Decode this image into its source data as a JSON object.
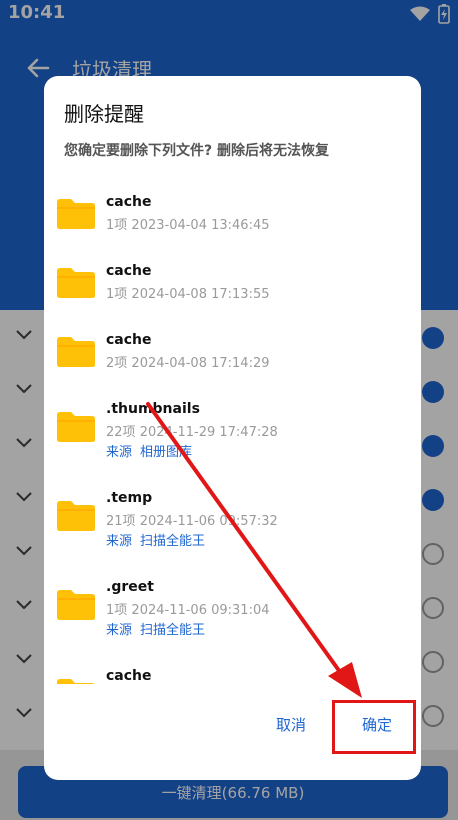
{
  "status": {
    "time": "10:41"
  },
  "app": {
    "title": "垃圾清理",
    "clean_button": "一键清理(66.76 MB)"
  },
  "dialog": {
    "title": "删除提醒",
    "message": "您确定要删除下列文件? 删除后将无法恢复",
    "cancel": "取消",
    "confirm": "确定",
    "files": [
      {
        "name": "cache",
        "count": "1项",
        "time": "2023-04-04 13:46:45",
        "source_label": "",
        "source": ""
      },
      {
        "name": "cache",
        "count": "1项",
        "time": "2024-04-08 17:13:55",
        "source_label": "",
        "source": ""
      },
      {
        "name": "cache",
        "count": "2项",
        "time": "2024-04-08 17:14:29",
        "source_label": "",
        "source": ""
      },
      {
        "name": ".thumbnails",
        "count": "22项",
        "time": "2024-11-29 17:47:28",
        "source_label": "来源",
        "source": "相册图库"
      },
      {
        "name": ".temp",
        "count": "21项",
        "time": "2024-11-06 09:57:32",
        "source_label": "来源",
        "source": "扫描全能王"
      },
      {
        "name": ".greet",
        "count": "1项",
        "time": "2024-11-06 09:31:04",
        "source_label": "来源",
        "source": "扫描全能王"
      },
      {
        "name": "cache",
        "count": "",
        "time": "",
        "source_label": "",
        "source": ""
      }
    ]
  },
  "colors": {
    "primary": "#1f66d1",
    "folder": "#ffc107",
    "annotation": "#e11616"
  }
}
